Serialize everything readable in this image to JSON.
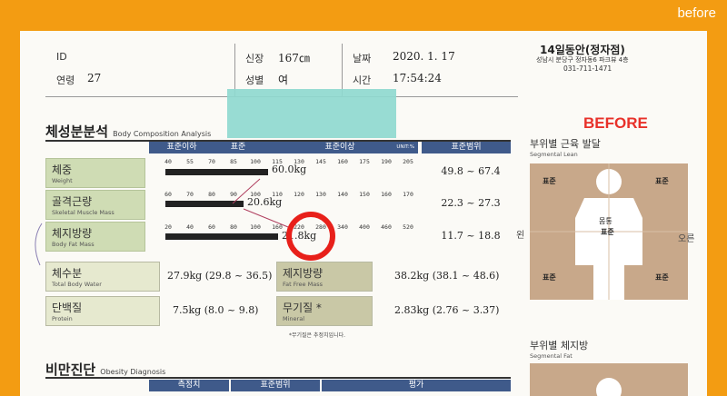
{
  "banner": {
    "tag": "before"
  },
  "header": {
    "id_label": "ID",
    "age_label": "연령",
    "age_value": "27",
    "height_label": "신장",
    "height_value": "167㎝",
    "sex_label": "성별",
    "sex_value": "여",
    "date_label": "날짜",
    "date_value": "2020. 1. 17",
    "time_label": "시간",
    "time_value": "17:54:24",
    "clinic_name": "14일동안(정자점)",
    "clinic_address": "성남시 분당구 정자동6 파크뷰 4층",
    "clinic_phone": "031-711-1471"
  },
  "overlay": {
    "before_label": "BEFORE"
  },
  "body_comp": {
    "title": "체성분분석",
    "subtitle": "Body Composition Analysis",
    "head_low": "표준이하",
    "head_std": "표준",
    "head_high": "표준이상",
    "head_unit": "UNIT:%",
    "head_range": "표준범위",
    "rows": [
      {
        "kr": "체중",
        "en": "Weight",
        "ticks": [
          "40",
          "55",
          "70",
          "85",
          "100",
          "115",
          "130",
          "145",
          "160",
          "175",
          "190",
          "205"
        ],
        "measure": "60.0kg",
        "range": "49.8 ~ 67.4"
      },
      {
        "kr": "골격근량",
        "en": "Skeletal Muscle Mass",
        "ticks": [
          "60",
          "70",
          "80",
          "90",
          "100",
          "110",
          "120",
          "130",
          "140",
          "150",
          "160",
          "170"
        ],
        "measure": "20.6kg",
        "range": "22.3 ~ 27.3"
      },
      {
        "kr": "체지방량",
        "en": "Body Fat Mass",
        "ticks": [
          "20",
          "40",
          "60",
          "80",
          "100",
          "160",
          "220",
          "280",
          "340",
          "400",
          "460",
          "520"
        ],
        "measure": "21.8kg",
        "range": "11.7 ~ 18.8"
      }
    ],
    "lower": [
      {
        "kr": "체수분",
        "en": "Total Body Water",
        "value": "27.9kg (29.8 ~ 36.5)"
      },
      {
        "kr": "제지방량",
        "en": "Fat Free Mass",
        "value": "38.2kg (38.1 ~ 48.6)"
      },
      {
        "kr": "단백질",
        "en": "Protein",
        "value": "7.5kg (8.0 ~ 9.8)"
      },
      {
        "kr": "무기질 *",
        "en": "Mineral",
        "value": "2.83kg (2.76 ~ 3.37)"
      }
    ],
    "footnote": "*무기질은 추정치입니다."
  },
  "bar_levels": {
    "weight_pct": 0.42,
    "muscle_pct": 0.32,
    "fat_pct": 0.46
  },
  "segmental_lean": {
    "title": "부위별 근육 발달",
    "subtitle": "Segmental Lean",
    "left_side": "왼",
    "right_side": "오른",
    "trunk_label": "몸통",
    "std": "표준"
  },
  "segmental_fat": {
    "title": "부위별 체지방",
    "subtitle": "Segmental Fat"
  },
  "obesity": {
    "title": "비만진단",
    "subtitle": "Obesity Diagnosis",
    "col_measure": "측정치",
    "col_range": "표준범위",
    "col_eval": "평가"
  },
  "colors": {
    "accent": "#f39c12",
    "table_head": "#3f5a8a",
    "row_label": "#cfdcb4",
    "marker": "#e8201a",
    "seg_panel": "#c8a88a"
  }
}
